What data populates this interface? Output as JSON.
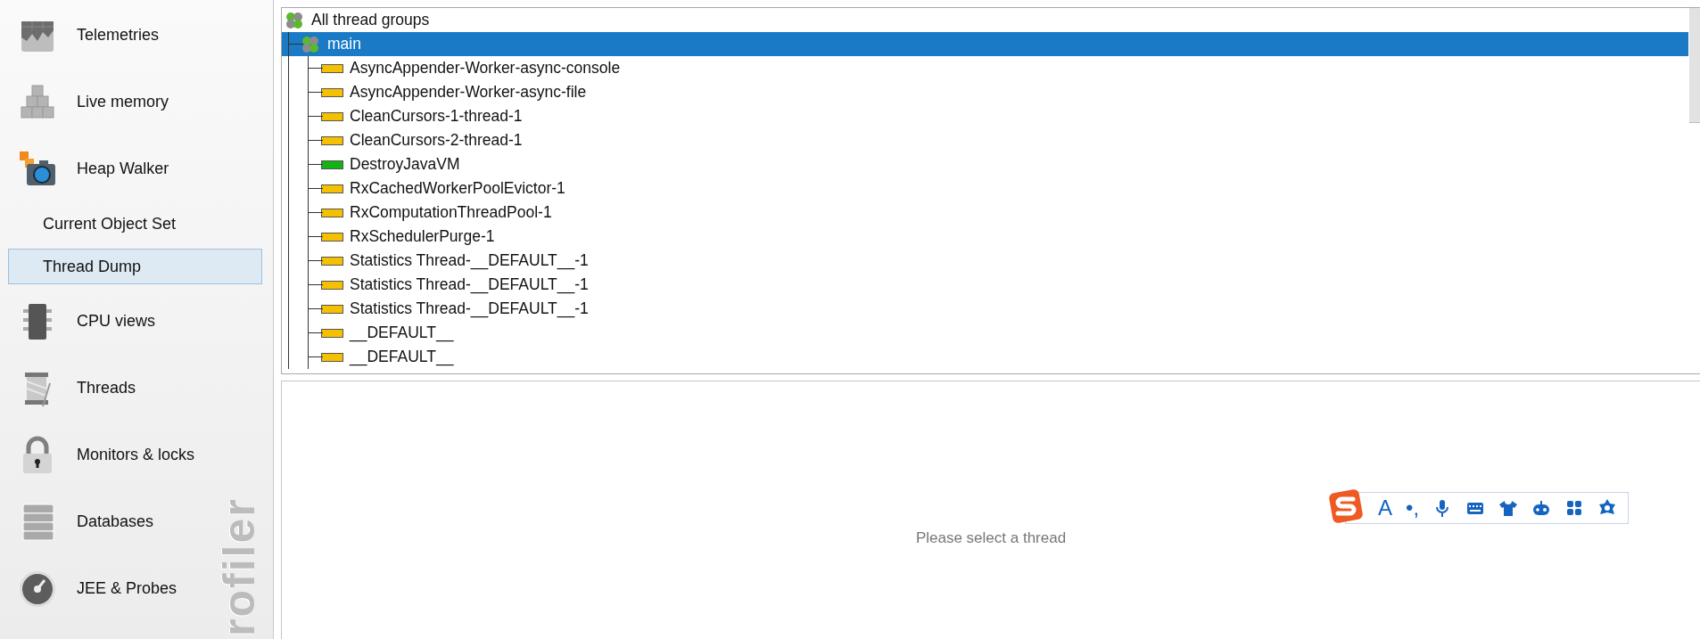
{
  "sidebar": {
    "items": [
      {
        "kind": "view",
        "label": "Telemetries",
        "selected": false
      },
      {
        "kind": "view",
        "label": "Live memory",
        "selected": false
      },
      {
        "kind": "view",
        "label": "Heap Walker",
        "selected": false
      },
      {
        "kind": "subview",
        "label": "Current Object Set",
        "selected": false
      },
      {
        "kind": "subview",
        "label": "Thread Dump",
        "selected": true
      },
      {
        "kind": "view",
        "label": "CPU views",
        "selected": false
      },
      {
        "kind": "view",
        "label": "Threads",
        "selected": false
      },
      {
        "kind": "view",
        "label": "Monitors & locks",
        "selected": false
      },
      {
        "kind": "view",
        "label": "Databases",
        "selected": false
      },
      {
        "kind": "view",
        "label": "JEE & Probes",
        "selected": false
      }
    ],
    "watermark": "rofiler"
  },
  "thread_tree": {
    "nodes": [
      {
        "kind": "group",
        "label": "All thread groups",
        "selected": false,
        "children": [
          {
            "kind": "group",
            "label": "main",
            "selected": true,
            "children": [
              {
                "kind": "thread",
                "label": "AsyncAppender-Worker-async-console",
                "color": "#f5c000",
                "selected": false
              },
              {
                "kind": "thread",
                "label": "AsyncAppender-Worker-async-file",
                "color": "#f5c000",
                "selected": false
              },
              {
                "kind": "thread",
                "label": "CleanCursors-1-thread-1",
                "color": "#f5c000",
                "selected": false
              },
              {
                "kind": "thread",
                "label": "CleanCursors-2-thread-1",
                "color": "#f5c000",
                "selected": false
              },
              {
                "kind": "thread",
                "label": "DestroyJavaVM",
                "color": "#12b312",
                "selected": false
              },
              {
                "kind": "thread",
                "label": "RxCachedWorkerPoolEvictor-1",
                "color": "#f5c000",
                "selected": false
              },
              {
                "kind": "thread",
                "label": "RxComputationThreadPool-1",
                "color": "#f5c000",
                "selected": false
              },
              {
                "kind": "thread",
                "label": "RxSchedulerPurge-1",
                "color": "#f5c000",
                "selected": false
              },
              {
                "kind": "thread",
                "label": "Statistics Thread-__DEFAULT__-1",
                "color": "#f5c000",
                "selected": false
              },
              {
                "kind": "thread",
                "label": "Statistics Thread-__DEFAULT__-1",
                "color": "#f5c000",
                "selected": false
              },
              {
                "kind": "thread",
                "label": "Statistics Thread-__DEFAULT__-1",
                "color": "#f5c000",
                "selected": false
              },
              {
                "kind": "thread",
                "label": "__DEFAULT__",
                "color": "#f5c000",
                "selected": false
              },
              {
                "kind": "thread",
                "label": "__DEFAULT__",
                "color": "#f5c000",
                "selected": false
              }
            ]
          }
        ]
      }
    ]
  },
  "detail": {
    "message": "Please select a thread"
  },
  "ime_toolbar": {
    "keys": [
      "A",
      "•,"
    ]
  }
}
